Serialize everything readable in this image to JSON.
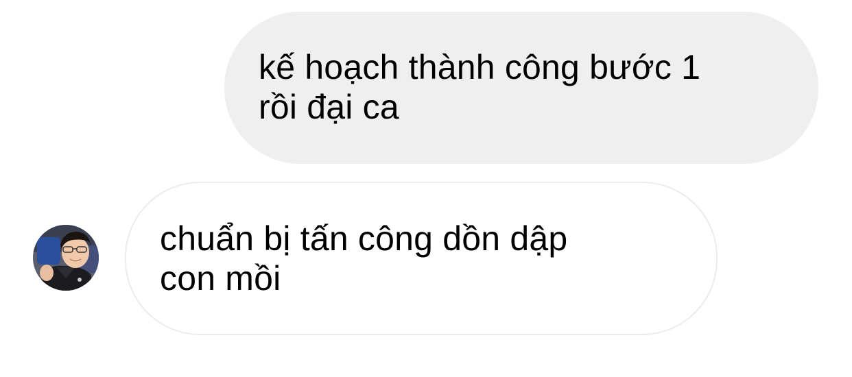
{
  "messages": [
    {
      "direction": "sent",
      "lines": [
        "kế hoạch thành công bước 1",
        "rồi đại ca"
      ]
    },
    {
      "direction": "received",
      "lines": [
        "chuẩn bị tấn công dồn dập",
        "con mồi"
      ]
    }
  ],
  "avatar": {
    "icon": "contact-avatar-photo"
  },
  "colors": {
    "sent_bubble": "#efefef",
    "received_bubble_border": "#ececec",
    "background": "#ffffff",
    "text": "#000000"
  }
}
